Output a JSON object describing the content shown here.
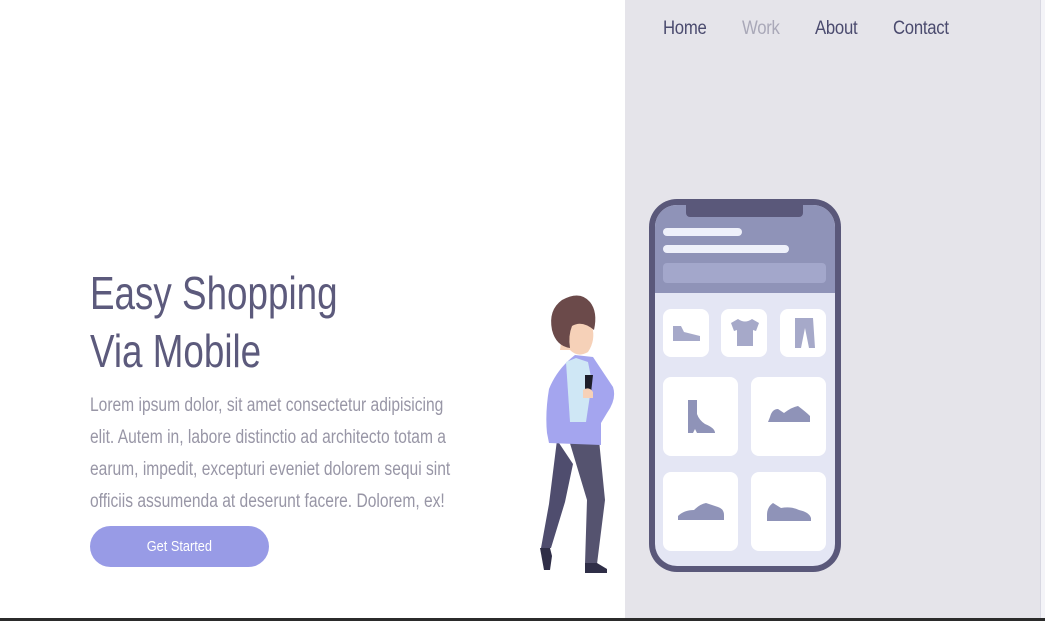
{
  "nav": {
    "items": [
      "Home",
      "Work",
      "About",
      "Contact"
    ]
  },
  "hero": {
    "title_line1": "Easy Shopping",
    "title_line2": "Via Mobile",
    "description": "Lorem ipsum dolor, sit amet consectetur adipisicing elit. Autem in, labore distinctio ad architecto totam a earum, impedit, excepturi eveniet dolorem sequi sint officiis assumenda at deserunt facere. Dolorem, ex!",
    "cta_label": "Get Started"
  },
  "colors": {
    "accent": "#989be6",
    "panel_bg": "#e5e4ea",
    "heading": "#5c5a7c",
    "phone_frame": "#5a587a",
    "product_icon": "#8f93b8"
  },
  "illustration": {
    "category_icons": [
      "shoe-icon",
      "tshirt-icon",
      "pants-icon"
    ],
    "product_icons": [
      "boot-icon",
      "sneaker-icon",
      "shoe-icon",
      "shoe-icon"
    ]
  }
}
